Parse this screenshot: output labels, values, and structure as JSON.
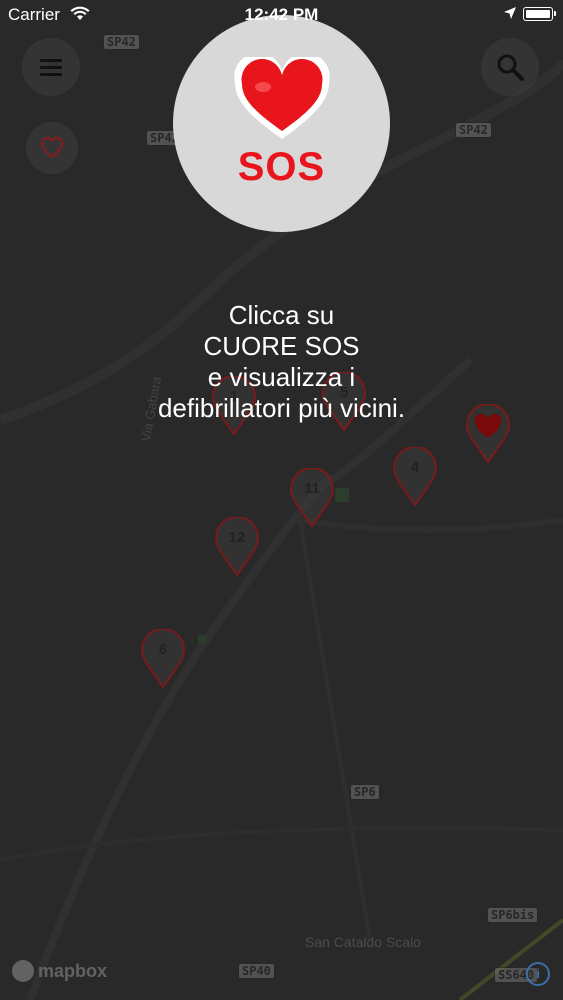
{
  "status_bar": {
    "carrier": "Carrier",
    "time": "12:42 PM"
  },
  "sos": {
    "label": "SOS",
    "heart_color": "#e8161c"
  },
  "instruction": {
    "line1": "Clicca su",
    "line2": "CUORE SOS",
    "line3": "e visualizza i",
    "line4": "defibrillatori più vicini."
  },
  "map": {
    "roads": [
      "SP42",
      "SP42",
      "SP42",
      "SP6",
      "SP6bis",
      "SP40",
      "SS640"
    ],
    "place_name": "San Cataldo Scalo",
    "street_name": "Via Gabara",
    "clusters": [
      "5",
      "4",
      "11",
      "12",
      "6",
      "1"
    ],
    "attribution": "mapbox",
    "info_label": "i"
  },
  "colors": {
    "accent": "#e8161c",
    "background": "#2a2a2a"
  }
}
